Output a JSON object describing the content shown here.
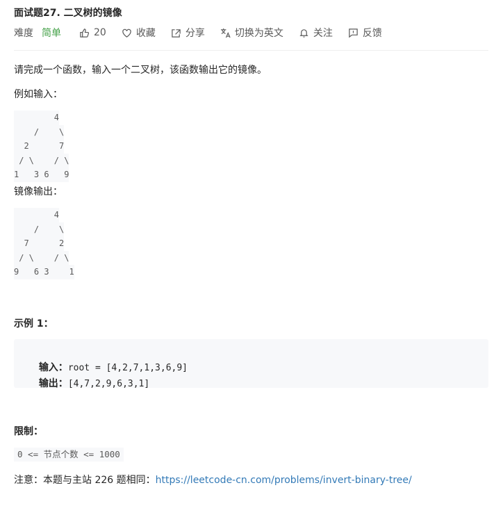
{
  "problem": {
    "title": "面试题27. 二叉树的镜像",
    "difficulty_label": "难度",
    "difficulty": "简单",
    "likes": "20",
    "favorite_label": "收藏",
    "share_label": "分享",
    "switch_lang_label": "切换为英文",
    "follow_label": "关注",
    "feedback_label": "反馈"
  },
  "description": {
    "intro": "请完成一个函数，输入一个二叉树，该函数输出它的镜像。",
    "input_example_label": "例如输入：",
    "input_tree": [
      "        4",
      "    /    \\",
      "  2      7",
      " / \\    / \\",
      "1   3 6   9"
    ],
    "output_example_label": "镜像输出：",
    "output_tree": [
      "        4",
      "    /    \\",
      "  7      2",
      " / \\    / \\",
      "9   6 3    1"
    ]
  },
  "example1": {
    "heading": "示例 1：",
    "input_label": "输入：",
    "input_value": "root = [4,2,7,1,3,6,9]",
    "output_label": "输出：",
    "output_value": "[4,7,2,9,6,3,1]"
  },
  "limits": {
    "heading": "限制：",
    "constraint": "0 <= 节点个数 <= 1000"
  },
  "note": {
    "prefix": "注意：本题与主站 226 题相同：",
    "link": "https://leetcode-cn.com/problems/invert-binary-tree/"
  },
  "icons": [
    "thumbs-up-icon",
    "heart-icon",
    "share-icon",
    "translate-icon",
    "bell-icon",
    "feedback-icon"
  ],
  "colors": {
    "easy": "#43a047",
    "link": "#337ab7",
    "code_bg": "#f7f8fa"
  }
}
